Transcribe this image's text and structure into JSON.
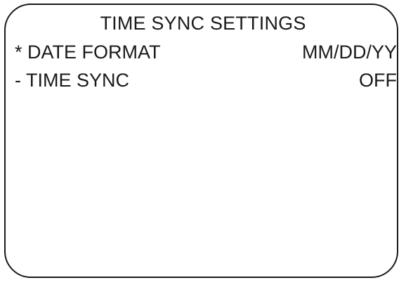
{
  "screen": {
    "title": "TIME SYNC SETTINGS"
  },
  "menu": {
    "items": [
      {
        "label": "* DATE FORMAT",
        "value": "MM/DD/YY"
      },
      {
        "label": "- TIME SYNC",
        "value": "OFF"
      }
    ]
  }
}
